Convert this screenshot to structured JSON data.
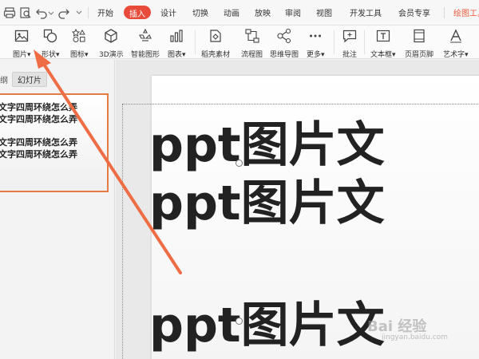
{
  "menubar": {
    "items": [
      "开始",
      "插入",
      "设计",
      "切换",
      "动画",
      "放映",
      "审阅",
      "视图",
      "开发工具",
      "会员专享"
    ],
    "active_index": 1,
    "right_item": "绘图工具",
    "accent_color": "#e94b3b"
  },
  "ribbon": {
    "tools": [
      {
        "label": "图片",
        "icon": "picture-icon",
        "dropdown": true
      },
      {
        "label": "形状",
        "icon": "shapes-icon",
        "dropdown": true
      },
      {
        "label": "图标",
        "icon": "icons-icon",
        "dropdown": true
      },
      {
        "label": "3D演示",
        "icon": "cube-icon",
        "dropdown": false
      },
      {
        "label": "智能图形",
        "icon": "smartart-icon",
        "dropdown": false
      },
      {
        "label": "图表",
        "icon": "chart-icon",
        "dropdown": true
      },
      {
        "label": "稻壳素材",
        "icon": "materials-icon",
        "dropdown": false
      },
      {
        "label": "流程图",
        "icon": "flowchart-icon",
        "dropdown": false
      },
      {
        "label": "思维导图",
        "icon": "mindmap-icon",
        "dropdown": false
      },
      {
        "label": "更多",
        "icon": "more-icon",
        "dropdown": true
      },
      {
        "label": "批注",
        "icon": "comment-icon",
        "dropdown": false
      },
      {
        "label": "文本框",
        "icon": "textbox-icon",
        "dropdown": true
      },
      {
        "label": "页眉页脚",
        "icon": "header-footer-icon",
        "dropdown": false
      },
      {
        "label": "艺术字",
        "icon": "wordart-icon",
        "dropdown": true
      }
    ]
  },
  "sidebar": {
    "tab_outline": "纲",
    "tab_slides": "幻灯片",
    "thumbnail_lines": [
      "文字四周环绕怎么弄",
      "文字四周环绕怎么弄",
      "文字四周环绕怎么弄",
      "文字四周环绕怎么弄"
    ],
    "selection_color": "#e37b43"
  },
  "slide": {
    "lines": [
      "ppt图片文",
      "ppt图片文",
      "ppt图片文"
    ]
  },
  "watermark": {
    "brand": "Bai 经验",
    "url": "jingyan.baidu.com"
  },
  "annotation": {
    "arrow_color": "#ee6d45"
  }
}
